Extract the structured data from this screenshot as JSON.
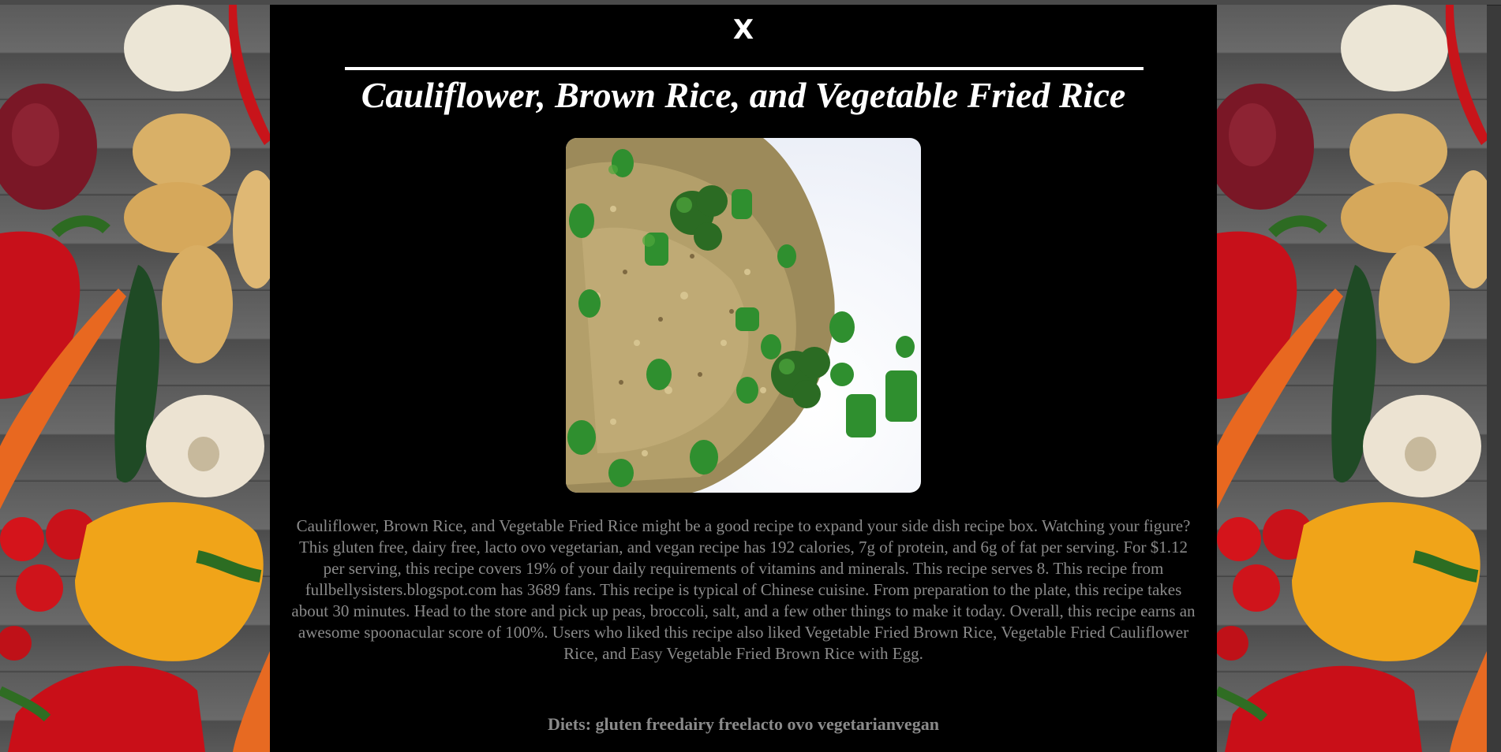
{
  "modal": {
    "close_label": "X",
    "title": "Cauliflower, Brown Rice, and Vegetable Fried Rice",
    "description": "Cauliflower, Brown Rice, and Vegetable Fried Rice might be a good recipe to expand your side dish recipe box. Watching your figure? This gluten free, dairy free, lacto ovo vegetarian, and vegan recipe has 192 calories, 7g of protein, and 6g of fat per serving. For $1.12 per serving, this recipe covers 19% of your daily requirements of vitamins and minerals. This recipe serves 8. This recipe from fullbellysisters.blogspot.com has 3689 fans. This recipe is typical of Chinese cuisine. From preparation to the plate, this recipe takes about 30 minutes. Head to the store and pick up peas, broccoli, salt, and a few other things to make it today. Overall, this recipe earns an awesome spoonacular score of 100%. Users who liked this recipe also liked Vegetable Fried Brown Rice, Vegetable Fried Cauliflower Rice, and Easy Vegetable Fried Brown Rice with Egg.",
    "diets_label": "Diets: gluten freedairy freelacto ovo vegetarianvegan"
  },
  "colors": {
    "modal_background": "#000000",
    "title_text": "#ffffff",
    "body_text": "#8a8a8a"
  }
}
